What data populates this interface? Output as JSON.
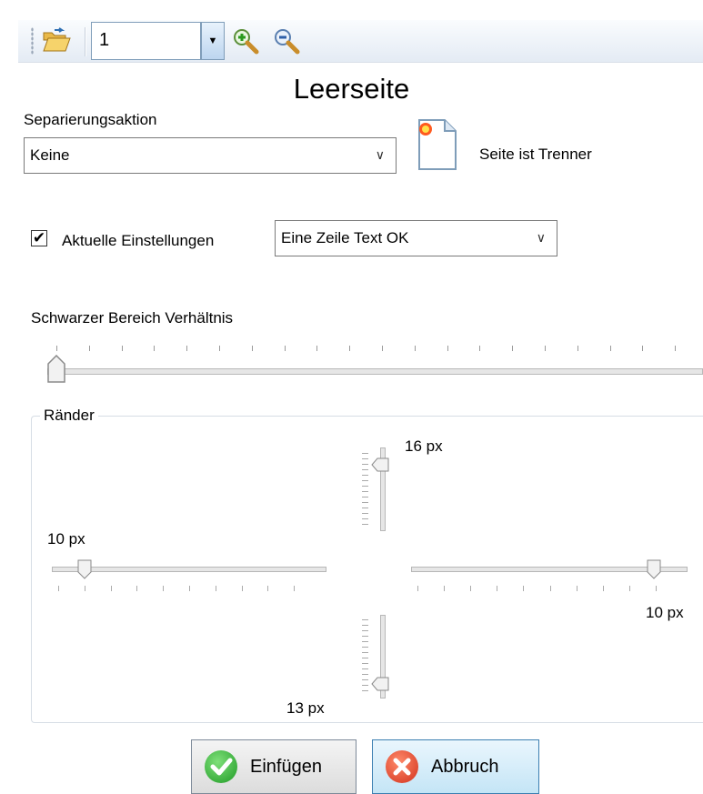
{
  "toolbar": {
    "page_value": "1",
    "open_icon": "folder-open-icon",
    "zoom_in_icon": "zoom-in-icon",
    "zoom_out_icon": "zoom-out-icon"
  },
  "page_title": "Leerseite",
  "separation": {
    "label": "Separierungsaktion",
    "selected": "Keine",
    "icon": "blank-page-icon",
    "status": "Seite ist Trenner"
  },
  "settings": {
    "checkbox_checked": true,
    "checkbox_label": "Aktuelle Einstellungen",
    "preset_selected": "Eine Zeile Text OK"
  },
  "black_area": {
    "label": "Schwarzer Bereich Verhältnis",
    "value_fraction": 0.0
  },
  "margins": {
    "legend": "Ränder",
    "top": "16 px",
    "left": "10 px",
    "right": "10 px",
    "bottom": "13 px"
  },
  "buttons": {
    "insert": "Einfügen",
    "cancel": "Abbruch"
  },
  "colors": {
    "accent": "#3c7fb1",
    "ok_green": "#2fae2f",
    "cancel_red": "#e0452c"
  }
}
